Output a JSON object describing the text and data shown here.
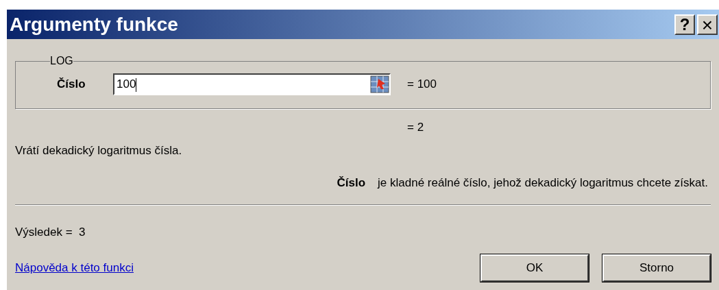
{
  "window": {
    "title": "Argumenty funkce",
    "help_button": "?",
    "close_button": "×"
  },
  "function_group": {
    "legend": "LOG",
    "arguments": [
      {
        "label": "Číslo",
        "value": "100",
        "evaluated": "= 100"
      }
    ]
  },
  "function_result": "= 2",
  "description": "Vrátí dekadický logaritmus čísla.",
  "argument_help": {
    "name": "Číslo",
    "text": "je kladné reálné číslo, jehož dekadický logaritmus chcete získat."
  },
  "result": {
    "label": "Výsledek =",
    "value": "3"
  },
  "help_link": "Nápověda k této funkci",
  "buttons": [
    "OK",
    "Storno"
  ]
}
